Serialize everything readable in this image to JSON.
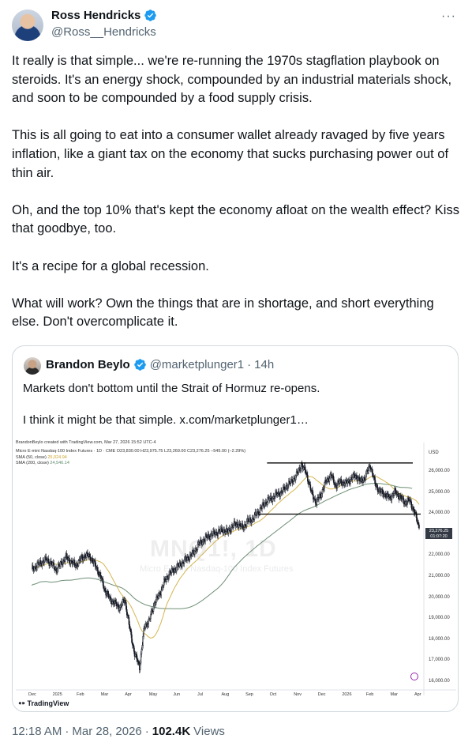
{
  "author": {
    "name": "Ross Hendricks",
    "handle": "@Ross__Hendricks"
  },
  "tweet": {
    "paragraphs": [
      "It really is that simple... we're re-running the 1970s stagflation playbook on steroids. It's an energy shock, compounded by an industrial materials shock, and soon to be compounded by a food supply crisis.",
      "This is all going to eat into a consumer wallet already ravaged by five years inflation, like a giant tax on the economy that sucks purchasing power out of thin air.",
      "Oh, and the top 10% that's kept the economy afloat on the wealth effect? Kiss that goodbye, too.",
      "It's a recipe for a global recession.",
      "What will work? Own the things that are in shortage, and short everything else. Don't overcomplicate it."
    ]
  },
  "quoted": {
    "name": "Brandon Beylo",
    "handle": "@marketplunger1",
    "separator": "·",
    "time": "14h",
    "lines": [
      "Markets don't bottom until the Strait of Hormuz re-opens.",
      "I think it might be that simple.  x.com/marketplunger1…"
    ]
  },
  "footer": {
    "time": "12:18 AM",
    "sep1": "·",
    "date": "Mar 28, 2026",
    "sep2": "·",
    "views": "102.4K",
    "views_label": "Views"
  },
  "chart_meta": {
    "credit": "BrandonBeylo created with TradingView.com, Mar 27, 2026 15:52 UTC-4",
    "symbol_line": "Micro E-mini Nasdaq-100 Index Futures · 1D · CME  O23,830.00  H23,975.75  L23,269.00  C23,276.25  −545.00 (−2.29%)",
    "sma50_label": "SMA (50, close)",
    "sma50_value": "25,024.94",
    "sma200_label": "SMA (200, close)",
    "sma200_value": "24,546.14",
    "watermark": "MNQ1!, 1D",
    "watermark_sub": "Micro E-mini Nasdaq-100 Index Futures",
    "currency": "USD",
    "last_price": "23,276.25",
    "countdown": "01:07:20",
    "logo": "TradingView",
    "sma50_color": "#c9a227",
    "sma200_color": "#6e8f76",
    "up_color": "#131722",
    "down_color": "#131722",
    "line_color": "#000000"
  },
  "chart_data": {
    "type": "candlestick",
    "y_ticks": [
      "26,000.00",
      "25,000.00",
      "24,000.00",
      "22,000.00",
      "21,000.00",
      "20,000.00",
      "19,000.00",
      "18,000.00",
      "17,000.00",
      "16,000.00"
    ],
    "x_ticks": [
      "Dec",
      "2025",
      "Feb",
      "Mar",
      "Apr",
      "May",
      "Jun",
      "Jul",
      "Aug",
      "Sep",
      "Oct",
      "Nov",
      "Dec",
      "2026",
      "Feb",
      "Mar",
      "Apr"
    ],
    "ylim": [
      15700,
      26900
    ],
    "resistance_level": 26380,
    "support_level": 23950,
    "close_path": [
      [
        "Dec",
        21300
      ],
      [
        "Dec",
        21500
      ],
      [
        "Dec",
        21650
      ],
      [
        "Dec",
        21800
      ],
      [
        "Dec",
        21600
      ],
      [
        "2025",
        21300
      ],
      [
        "2025",
        21600
      ],
      [
        "2025",
        21900
      ],
      [
        "2025",
        21700
      ],
      [
        "2025",
        21500
      ],
      [
        "Feb",
        21800
      ],
      [
        "Feb",
        22000
      ],
      [
        "Feb",
        21900
      ],
      [
        "Feb",
        21500
      ],
      [
        "Feb",
        21000
      ],
      [
        "Mar",
        20300
      ],
      [
        "Mar",
        19900
      ],
      [
        "Mar",
        19700
      ],
      [
        "Mar",
        19500
      ],
      [
        "Mar",
        19900
      ],
      [
        "Apr",
        18500
      ],
      [
        "Apr",
        17300
      ],
      [
        "Apr",
        16700
      ],
      [
        "Apr",
        18600
      ],
      [
        "Apr",
        18900
      ],
      [
        "May",
        19700
      ],
      [
        "May",
        20100
      ],
      [
        "May",
        20700
      ],
      [
        "May",
        21100
      ],
      [
        "May",
        21300
      ],
      [
        "Jun",
        21500
      ],
      [
        "Jun",
        21700
      ],
      [
        "Jun",
        21900
      ],
      [
        "Jun",
        22100
      ],
      [
        "Jun",
        22500
      ],
      [
        "Jul",
        22700
      ],
      [
        "Jul",
        22900
      ],
      [
        "Jul",
        23000
      ],
      [
        "Jul",
        23100
      ],
      [
        "Jul",
        23200
      ],
      [
        "Aug",
        23100
      ],
      [
        "Aug",
        23400
      ],
      [
        "Aug",
        23500
      ],
      [
        "Aug",
        23300
      ],
      [
        "Aug",
        23600
      ],
      [
        "Sep",
        23700
      ],
      [
        "Sep",
        24000
      ],
      [
        "Sep",
        24300
      ],
      [
        "Sep",
        24600
      ],
      [
        "Sep",
        24700
      ],
      [
        "Oct",
        24900
      ],
      [
        "Oct",
        25000
      ],
      [
        "Oct",
        25300
      ],
      [
        "Oct",
        25500
      ],
      [
        "Oct",
        25800
      ],
      [
        "Nov",
        26300
      ],
      [
        "Nov",
        25900
      ],
      [
        "Nov",
        25000
      ],
      [
        "Nov",
        24500
      ],
      [
        "Nov",
        24900
      ],
      [
        "Dec",
        25500
      ],
      [
        "Dec",
        25800
      ],
      [
        "Dec",
        25300
      ],
      [
        "Dec",
        25500
      ],
      [
        "Dec",
        25400
      ],
      [
        "2026",
        25600
      ],
      [
        "2026",
        25800
      ],
      [
        "2026",
        25500
      ],
      [
        "2026",
        25700
      ],
      [
        "2026",
        26300
      ],
      [
        "Feb",
        25400
      ],
      [
        "Feb",
        25000
      ],
      [
        "Feb",
        24900
      ],
      [
        "Feb",
        24700
      ],
      [
        "Feb",
        25000
      ],
      [
        "Mar",
        24800
      ],
      [
        "Mar",
        24500
      ],
      [
        "Mar",
        24600
      ],
      [
        "Mar",
        24100
      ],
      [
        "Mar",
        23276
      ]
    ],
    "series": [
      {
        "name": "SMA (50, close)",
        "last_value": 25024.94
      },
      {
        "name": "SMA (200, close)",
        "last_value": 24546.14
      }
    ]
  }
}
